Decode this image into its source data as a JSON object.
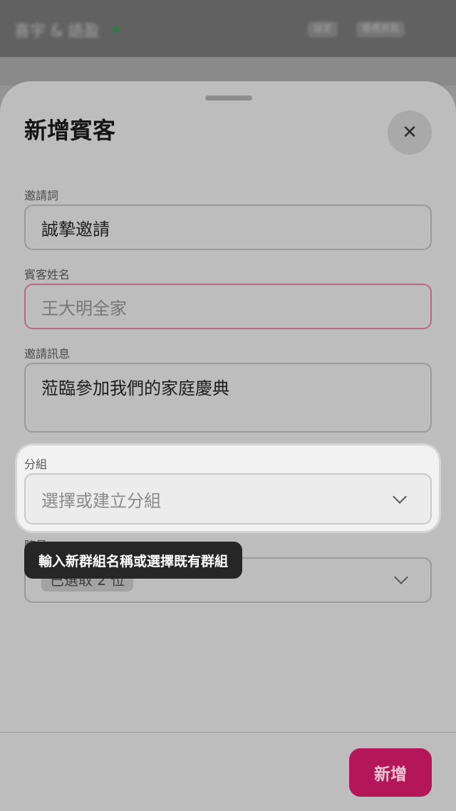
{
  "background": {
    "app_title": "喜宇 & 語盈",
    "header_pill_1": "設定",
    "header_pill_2": "婚禮頁面",
    "status_dot_color": "#1f8f4a"
  },
  "sheet": {
    "title": "新增賓客",
    "close_icon": "close-icon",
    "fields": {
      "invitation_word": {
        "label": "邀請詞",
        "value": "誠摯邀請"
      },
      "guest_name": {
        "label": "賓客姓名",
        "placeholder": "王大明全家"
      },
      "invitation_message": {
        "label": "邀請訊息",
        "value": "蒞臨參加我們的家庭慶典"
      },
      "group": {
        "label": "分組",
        "placeholder": "選擇或建立分組"
      },
      "attendees": {
        "label": "隨員",
        "chip": "已選取 2 位"
      }
    },
    "tooltip": "輸入新群組名稱或選擇既有群組",
    "submit_label": "新增"
  },
  "colors": {
    "accent": "#b3175a",
    "error_border": "#b76c86",
    "tooltip_bg": "#262626"
  }
}
